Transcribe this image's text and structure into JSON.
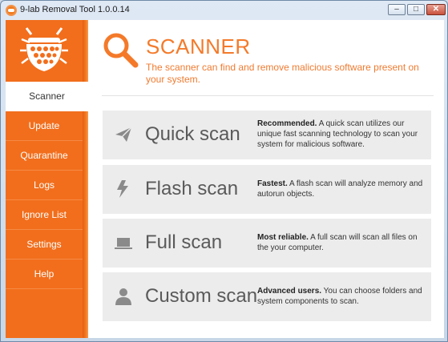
{
  "window": {
    "title": "9-lab Removal Tool 1.0.0.14"
  },
  "sidebar": {
    "items": [
      {
        "label": "Scanner",
        "active": true
      },
      {
        "label": "Update"
      },
      {
        "label": "Quarantine"
      },
      {
        "label": "Logs"
      },
      {
        "label": "Ignore List"
      },
      {
        "label": "Settings"
      },
      {
        "label": "Help"
      }
    ]
  },
  "header": {
    "title": "SCANNER",
    "description": "The scanner can find and remove malicious software present on your system."
  },
  "scans": [
    {
      "title": "Quick scan",
      "icon": "paper-plane-icon",
      "emphasis": "Recommended.",
      "text": " A quick scan utilizes our unique fast scanning technology to scan your system for malicious software."
    },
    {
      "title": "Flash scan",
      "icon": "lightning-icon",
      "emphasis": "Fastest.",
      "text": " A flash scan will analyze memory and autorun objects."
    },
    {
      "title": "Full scan",
      "icon": "laptop-icon",
      "emphasis": "Most reliable.",
      "text": " A full scan will scan all files on the your computer."
    },
    {
      "title": "Custom scan",
      "icon": "user-icon",
      "emphasis": "Advanced users.",
      "text": " You can choose folders and system components to scan."
    }
  ],
  "colors": {
    "accent": "#f26e1c",
    "card_bg": "#ececec",
    "title_text": "#f47a2a"
  }
}
